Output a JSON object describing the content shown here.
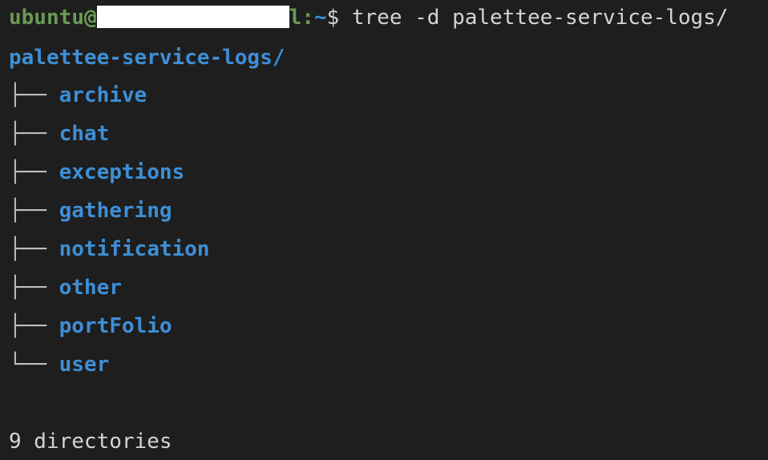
{
  "prompt": {
    "user": "ubuntu@",
    "host_tail": "l",
    "separator": ":",
    "path": "~",
    "dollar": "$",
    "command": "tree -d palettee-service-logs/"
  },
  "tree": {
    "root": "palettee-service-logs/",
    "entries": [
      {
        "branch": "├── ",
        "name": "archive"
      },
      {
        "branch": "├── ",
        "name": "chat"
      },
      {
        "branch": "├── ",
        "name": "exceptions"
      },
      {
        "branch": "├── ",
        "name": "gathering"
      },
      {
        "branch": "├── ",
        "name": "notification"
      },
      {
        "branch": "├── ",
        "name": "other"
      },
      {
        "branch": "├── ",
        "name": "portFolio"
      },
      {
        "branch": "└── ",
        "name": "user"
      }
    ],
    "summary": "9 directories"
  },
  "colors": {
    "background": "#1e1e1e",
    "prompt_user": "#6a9955",
    "directory": "#3d8fd6",
    "text": "#d4d4d4",
    "redaction": "#ffffff"
  }
}
